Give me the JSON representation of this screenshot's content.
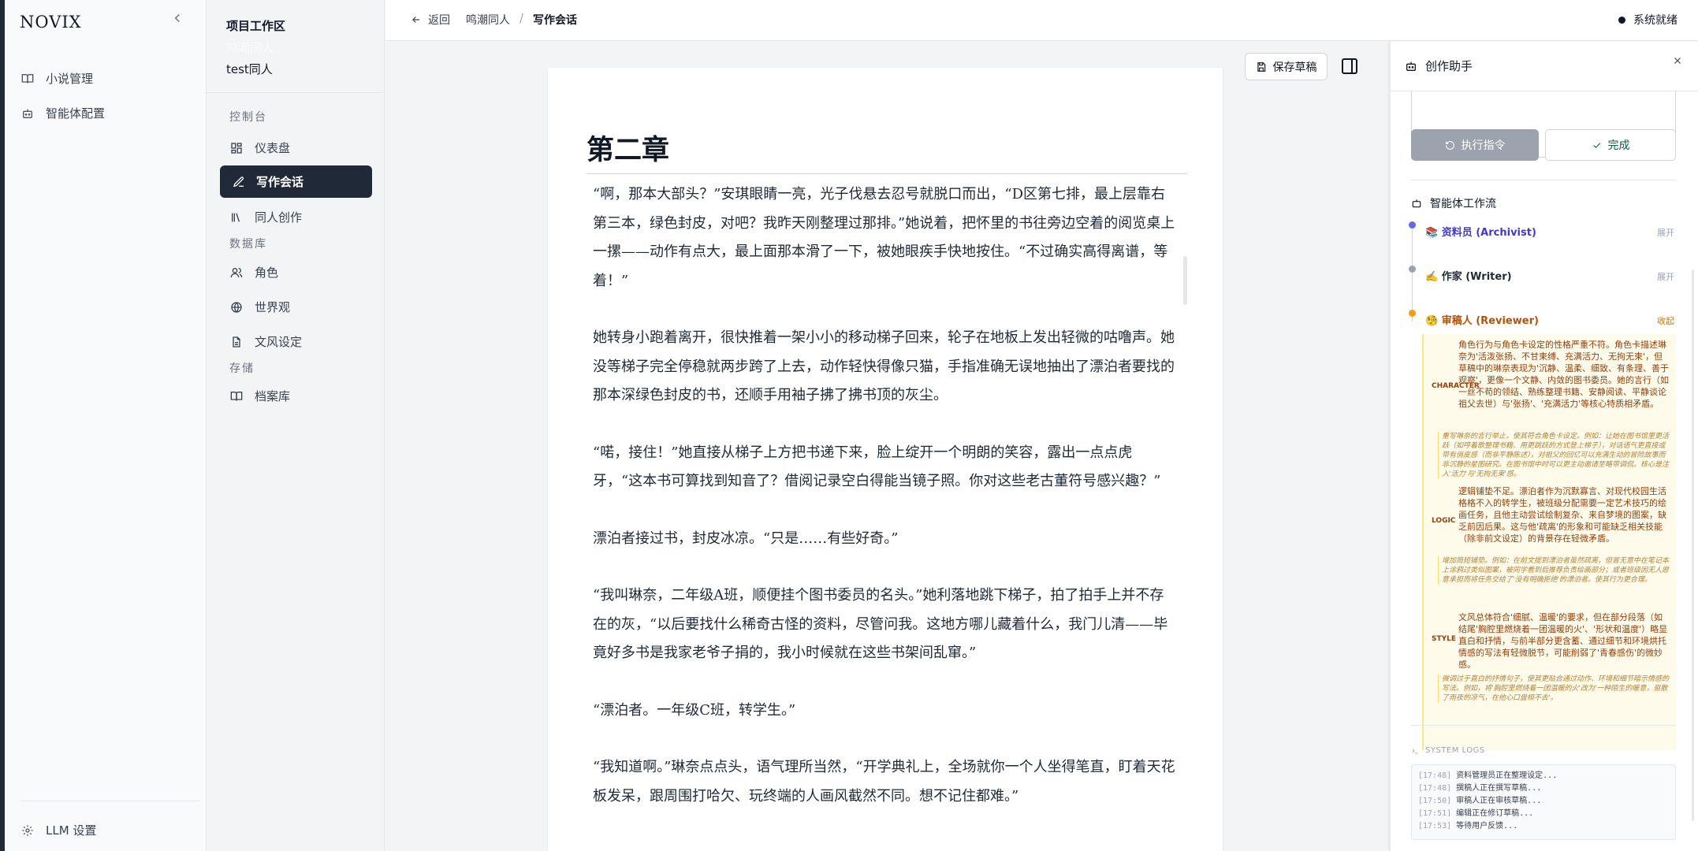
{
  "sidebar": {
    "logo": "NOVIX",
    "items": [
      {
        "label": "小说管理",
        "icon": "book-icon"
      },
      {
        "label": "智能体配置",
        "icon": "robot-icon"
      }
    ],
    "footer": {
      "label": "LLM 设置",
      "icon": "gear-icon"
    }
  },
  "workspace": {
    "title": "项目工作区",
    "faded_name": "鸣潮同人",
    "project": "test同人",
    "sections": [
      {
        "label": "控制台"
      },
      {
        "label": "数据库"
      },
      {
        "label": "存储"
      }
    ],
    "items": [
      {
        "label": "仪表盘",
        "icon": "dashboard-icon"
      },
      {
        "label": "写作会话",
        "icon": "pen-icon",
        "active": true
      },
      {
        "label": "同人创作",
        "icon": "library-icon"
      },
      {
        "label": "角色",
        "icon": "users-icon"
      },
      {
        "label": "世界观",
        "icon": "globe-icon"
      },
      {
        "label": "文风设定",
        "icon": "file-icon"
      },
      {
        "label": "档案库",
        "icon": "book-open-icon"
      }
    ]
  },
  "topbar": {
    "back_label": "返回",
    "crumb_project": "鸣潮同人",
    "crumb_sep": "/",
    "crumb_current": "写作会话",
    "status": "系统就绪"
  },
  "editor": {
    "save_label": "保存草稿",
    "chapter_title": "第二章",
    "paragraphs": [
      "“啊，那本大部头？”安琪眼睛一亮，光子伐悬去忍号就脱口而出，“D区第七排，最上层靠右第三本，绿色封皮，对吧？我昨天刚整理过那排。”她说着，把怀里的书往旁边空着的阅览桌上一摞——动作有点大，最上面那本滑了一下，被她眼疾手快地按住。“不过确实高得离谱，等着！”",
      "她转身小跑着离开，很快推着一架小小的移动梯子回来，轮子在地板上发出轻微的咕噜声。她没等梯子完全停稳就两步跨了上去，动作轻快得像只猫，手指准确无误地抽出了漂泊者要找的那本深绿色封皮的书，还顺手用袖子拂了拂书顶的灰尘。",
      "“喏，接住！”她直接从梯子上方把书递下来，脸上绽开一个明朗的笑容，露出一点点虎牙，“这本书可算找到知音了？借阅记录空白得能当镜子照。你对这些老古董符号感兴趣？”",
      "漂泊者接过书，封皮冰凉。“只是……有些好奇。”",
      "“我叫琳奈，二年级A班，顺便挂个图书委员的名头。”她利落地跳下梯子，拍了拍手上并不存在的灰，“以后要找什么稀奇古怪的资料，尽管问我。这地方哪儿藏着什么，我门儿清——毕竟好多书是我家老爷子捐的，我小时候就在这些书架间乱窜。”",
      "“漂泊者。一年级C班，转学生。”",
      "“我知道啊。”琳奈点点头，语气理所当然，“开学典礼上，全场就你一个人坐得笔直，盯着天花板发呆，跟周围打哈欠、玩终端的人画风截然不同。想不记住都难。”"
    ]
  },
  "assistant": {
    "title": "创作助手",
    "exec_label": "执行指令",
    "done_label": "完成",
    "workflow_title": "智能体工作流",
    "agents": [
      {
        "name": "📚 资料员 (Archivist)",
        "action": "展开",
        "color": "#6366f1"
      },
      {
        "name": "✍️ 作家 (Writer)",
        "action": "展开",
        "color": "#9ca3af"
      },
      {
        "name": "🧐 审稿人 (Reviewer)",
        "action": "收起",
        "color": "#f59e0b"
      }
    ],
    "reviews": [
      {
        "tag": "CHARACTER",
        "issue": "角色行为与角色卡设定的性格严重不符。角色卡描述琳奈为'活泼张扬、不甘束缚、充满活力、无拘无束'，但草稿中的琳奈表现为'沉静、温柔、细致、有条理、善于观察'，更像一个文静、内敛的图书委员。她的言行（如一丝不苟的领结、熟练整理书籍、安静阅读、平静谈论祖父去世）与'张扬'、'充满活力'等核心特质相矛盾。",
        "suggestion": "重写琳奈的言行举止，使其符合角色卡设定。例如：让她在图书馆里更活跃（如哼着歌整理书籍、用更跳跃的方式登上梯子），对话语气更直接或带有俏皮感（而非平静陈述），对祖父的回忆可以充满生动的冒险故事而非沉静的星图研究。在图书馆中时可以更主动邀请至略带调侃。核心是注入'活力'与'无拘无束'感。"
      },
      {
        "tag": "LOGIC",
        "issue": "逻辑铺垫不足。漂泊者作为沉默寡言、对现代校园生活格格不入的转学生，被班级分配需要一定艺术技巧的绘画任务，且他主动尝试绘制复杂、来自梦境的图案，缺乏前因后果。这与他'疏离'的形象和可能缺乏相关技能（除非前文设定）的背景存在轻微矛盾。",
        "suggestion": "增加简短铺垫。例如：在前文提到漂泊者虽然疏离，但冒无意中在笔记本上涂鸦过类似图案，被同学看到后推荐负责绘画部分；或者班级因无人愿意承担而将任务交给了'没有明确拒绝'的漂泊者。使其行为更合理。"
      },
      {
        "tag": "STYLE",
        "issue": "文风总体符合'细腻、温暖'的要求，但在部分段落（如结尾'胸腔里燃烧着一团温暖的火'、'形状和温度'）略显直白和抒情，与前半部分更含蓄、通过细节和环境烘托情感的写法有轻微脱节，可能削弱了'青春感伤'的微妙感。",
        "suggestion": "微调过于直白的抒情句子，使其更贴合通过动作、环境和细节暗示情感的写法。例如，将'胸腔里燃烧着一团温暖的火'改为'一种陌生的暖意，驱散了雨夜的凉气，在他心口盘桓不去'。"
      }
    ],
    "logs_title": "SYSTEM LOGS",
    "logs": [
      {
        "time": "[17:48]",
        "text": "资料管理员正在整理设定..."
      },
      {
        "time": "[17:48]",
        "text": "撰稿人正在撰写草稿..."
      },
      {
        "time": "[17:50]",
        "text": "审稿人正在审核草稿..."
      },
      {
        "time": "[17:51]",
        "text": "编辑正在修订草稿..."
      },
      {
        "time": "[17:53]",
        "text": "等待用户反馈..."
      }
    ]
  },
  "colors": {
    "accent_dark": "#1f2937",
    "review_bg": "#fffbeb",
    "review_text": "#92400e",
    "done_green": "#065f46"
  }
}
